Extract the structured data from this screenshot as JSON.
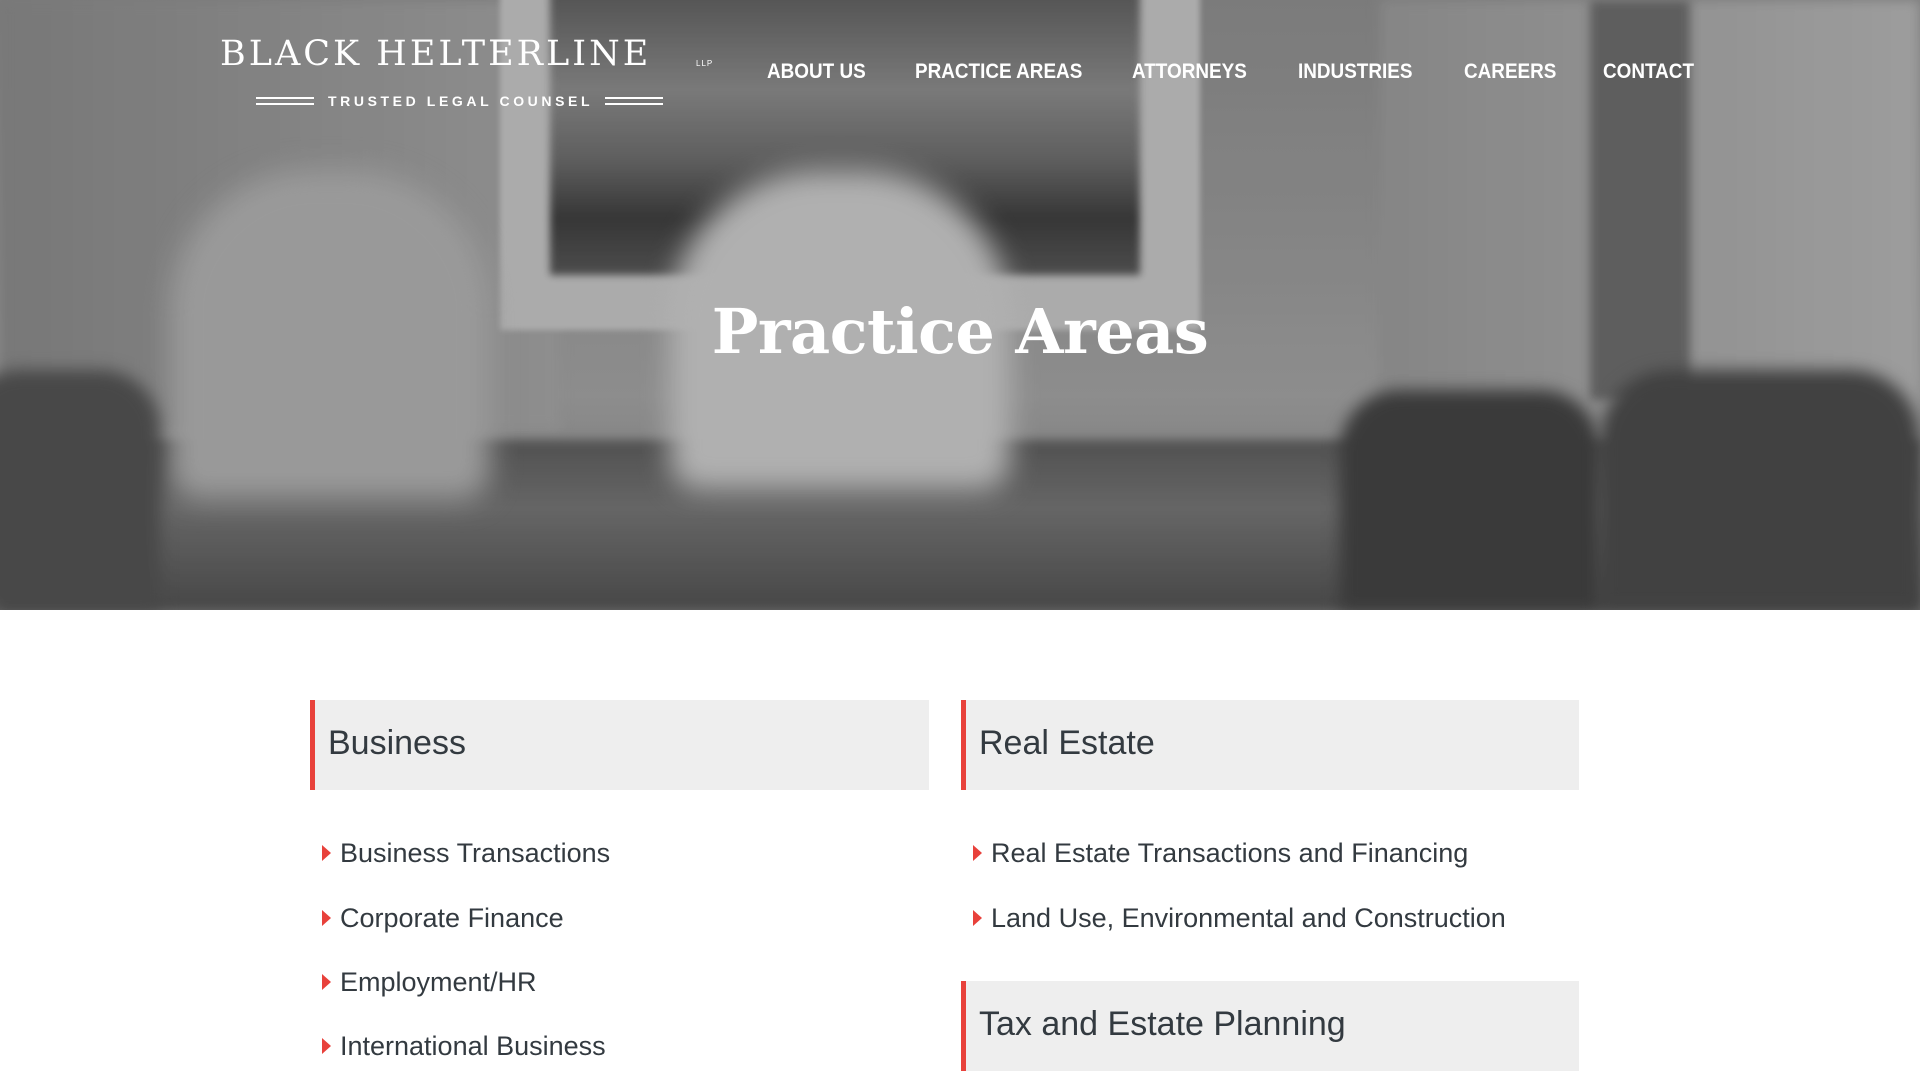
{
  "brand": {
    "name": "BLACK HELTERLINE",
    "suffix": "LLP",
    "tagline": "TRUSTED LEGAL COUNSEL"
  },
  "nav": {
    "items": [
      {
        "label": "ABOUT US"
      },
      {
        "label": "PRACTICE AREAS"
      },
      {
        "label": "ATTORNEYS"
      },
      {
        "label": "INDUSTRIES"
      },
      {
        "label": "CAREERS"
      },
      {
        "label": "CONTACT"
      }
    ]
  },
  "hero": {
    "title": "Practice Areas"
  },
  "colors": {
    "accent": "#e8413b",
    "heading_bg": "#eeeeee",
    "text": "#333a40"
  },
  "practice_areas": [
    {
      "title": "Business",
      "items": [
        "Business Transactions",
        "Corporate Finance",
        "Employment/HR",
        "International Business"
      ]
    },
    {
      "title": "Real Estate",
      "items": [
        "Real Estate Transactions and Financing",
        "Land Use, Environmental and Construction"
      ]
    },
    {
      "title": "Tax and Estate Planning",
      "items": []
    }
  ]
}
